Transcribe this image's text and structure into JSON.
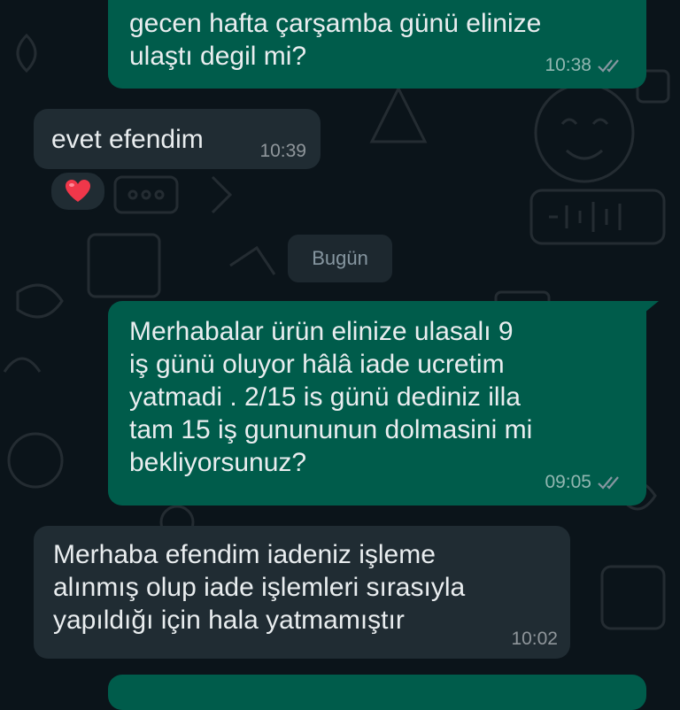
{
  "day_separator": "Bugün",
  "messages": [
    {
      "direction": "outgoing",
      "text": "gecen hafta çarşamba günü elinize\nulaştı degil mi?",
      "time": "10:38",
      "status": "read"
    },
    {
      "direction": "incoming",
      "text": "evet efendim",
      "time": "10:39",
      "reaction": "heart-emoji"
    },
    {
      "direction": "outgoing",
      "text": "Merhabalar ürün elinize ulasalı 9\niş günü oluyor hâlâ iade ucretim\nyatmadi . 2/15 is günü dediniz illa\ntam 15 iş gunununun dolmasini mi\nbekliyorsunuz?",
      "time": "09:05",
      "status": "read"
    },
    {
      "direction": "incoming",
      "text": "Merhaba efendim iadeniz işleme\nalınmış olup iade işlemleri sırasıyla\nyapıldığı için hala yatmamıştır",
      "time": "10:02"
    }
  ],
  "colors": {
    "background": "#0b141a",
    "outgoing_bubble": "#005c4b",
    "incoming_bubble": "#202c33",
    "read_ticks": "#8696a0"
  }
}
